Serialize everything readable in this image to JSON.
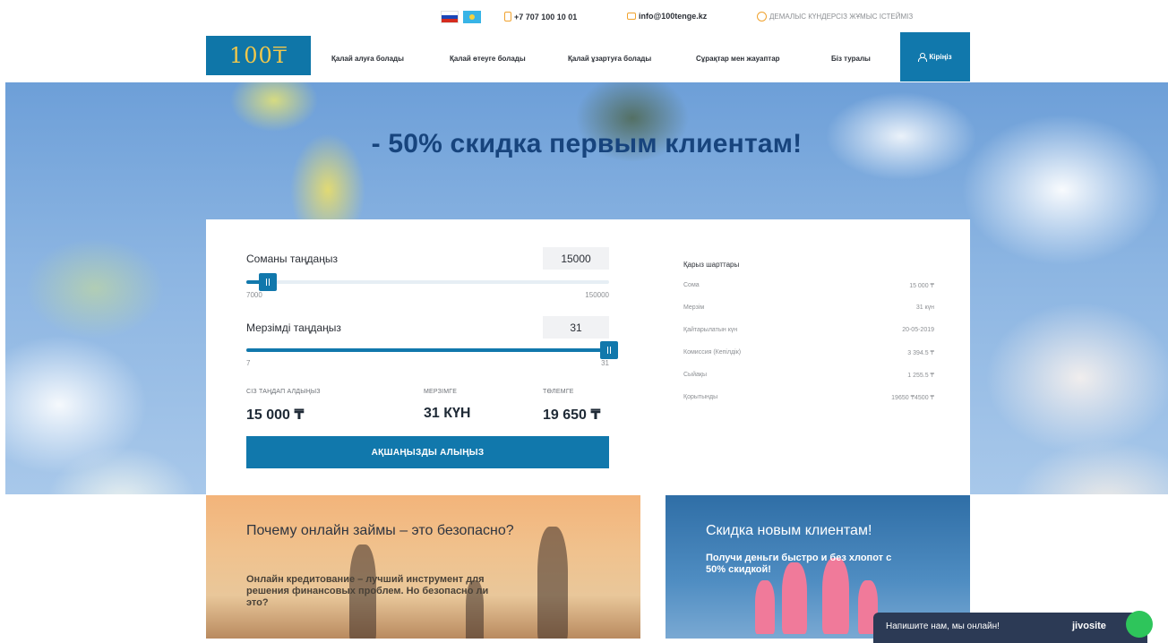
{
  "topbar": {
    "phone": "+7 707 100 10 01",
    "email": "info@100tenge.kz",
    "hours": "ДЕМАЛЫС КҮНДЕРСІЗ ЖҰМЫС ІСТЕЙМІЗ"
  },
  "nav": {
    "logo": "100₸",
    "links": [
      "Қалай алуға болады",
      "Қалай өтеуге болады",
      "Қалай ұзартуға болады",
      "Сұрақтар мен жауаптар",
      "Біз туралы"
    ],
    "login": "Кіріңіз"
  },
  "hero": {
    "title": "- 50% скидка первым клиентам!"
  },
  "calculator": {
    "amount": {
      "label": "Соманы таңдаңыз",
      "value": "15000",
      "min": "7000",
      "max": "150000",
      "fraction": 0.06
    },
    "term": {
      "label": "Мерзімді таңдаңыз",
      "value": "31",
      "min": "7",
      "max": "31",
      "fraction": 1.0
    },
    "summary": [
      {
        "label": "СІЗ ТАҢДАП АЛДЫҢЫЗ",
        "value": "15 000 ₸"
      },
      {
        "label": "МЕРЗІМГЕ",
        "value": "31 КҮН"
      },
      {
        "label": "ТӨЛЕМГЕ",
        "value": "19 650 ₸"
      }
    ],
    "cta": "АҚШАҢЫЗДЫ АЛЫҢЫЗ",
    "terms_title": "Қарыз шарттары",
    "terms": [
      {
        "label": "Сома",
        "value": "15 000 ₸"
      },
      {
        "label": "Мерзім",
        "value": "31 күн"
      },
      {
        "label": "Қайтарылатын күн",
        "value": "20-05-2019"
      },
      {
        "label": "Комиссия (Кепілдік)",
        "value": "3 394.5 ₸"
      },
      {
        "label": "Сыйақы",
        "value": "1 255.5 ₸"
      },
      {
        "label": "Қорытынды",
        "value": "19650 ₸4500 ₸"
      }
    ]
  },
  "promos": {
    "left": {
      "title": "Почему онлайн займы – это безопасно?",
      "text": "Онлайн кредитование – лучший инструмент для решения финансовых проблем. Но безопасно ли это?"
    },
    "right": {
      "title": "Скидка новым клиентам!",
      "text": "Получи деньги быстро и без хлопот с 50% скидкой!"
    }
  },
  "chat": {
    "text": "Напишите нам, мы онлайн!",
    "brand": "jivosite"
  },
  "colors": {
    "primary": "#1178ac",
    "accent": "#f0a22e",
    "title": "#17447d"
  }
}
